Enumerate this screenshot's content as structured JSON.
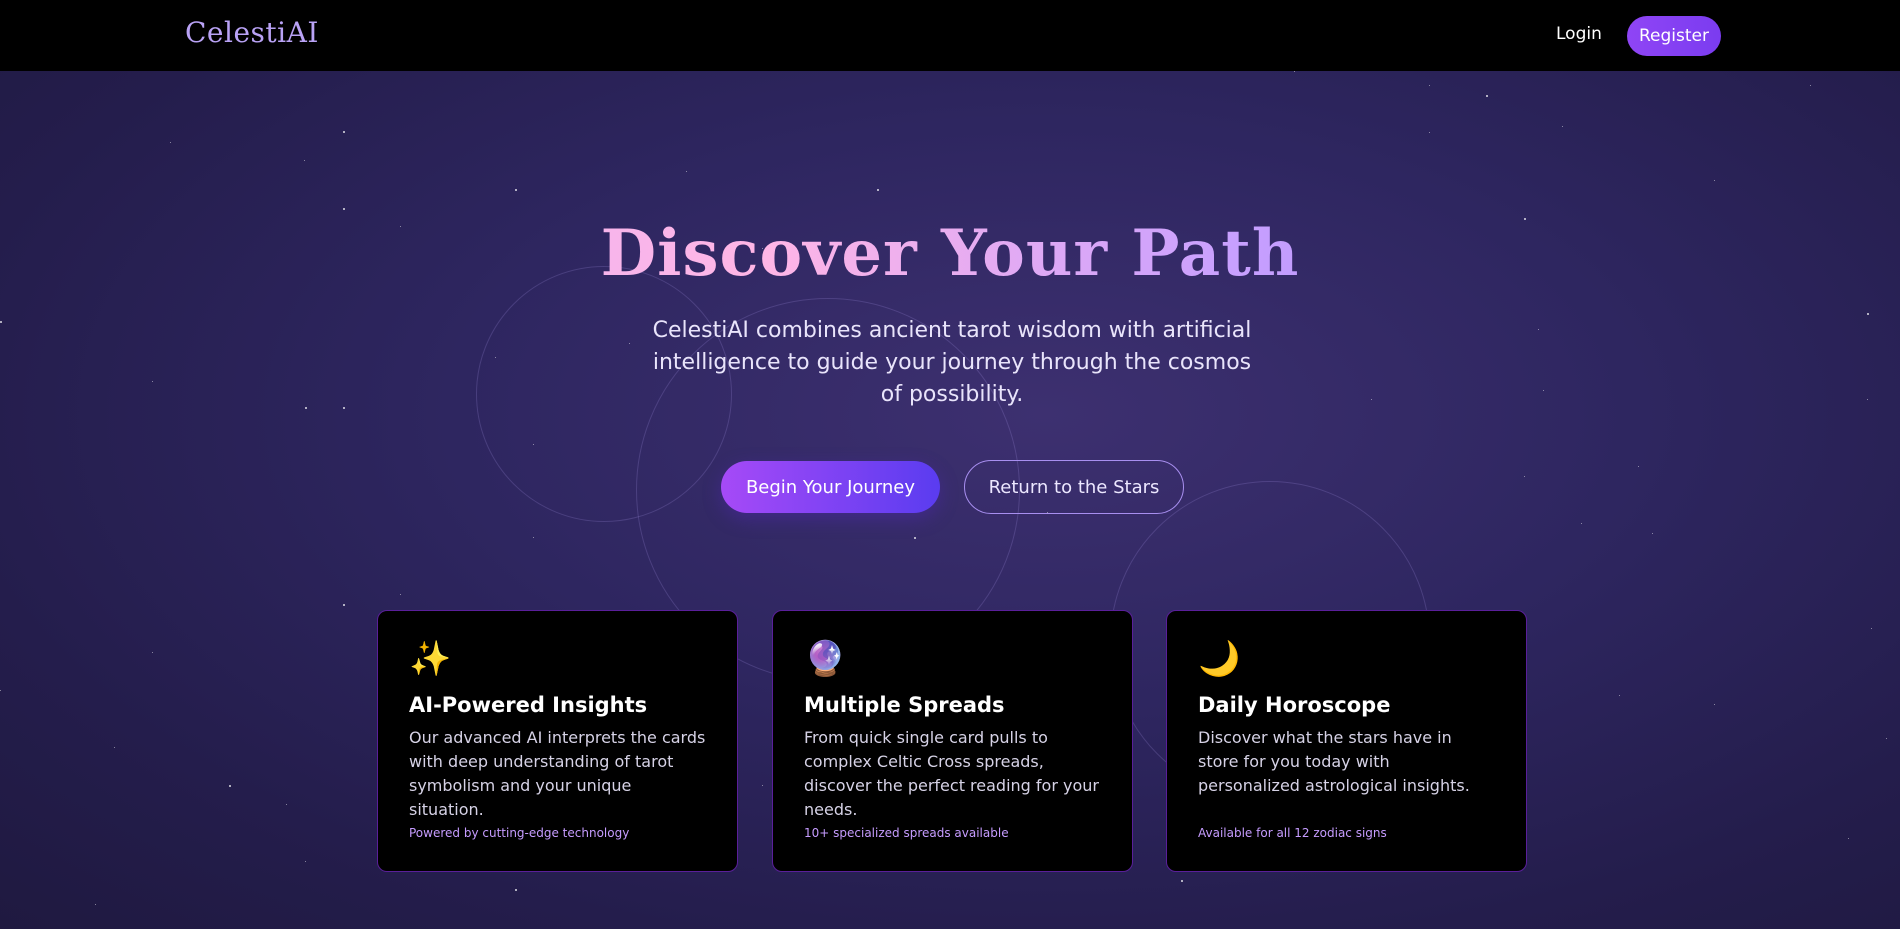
{
  "nav": {
    "brand": "CelestiAI",
    "login": "Login",
    "register": "Register"
  },
  "hero": {
    "title": "Discover Your Path",
    "subtitle": "CelestiAI combines ancient tarot wisdom with artificial intelligence to guide your journey through the cosmos of possibility.",
    "primary_button": "Begin Your Journey",
    "secondary_button": "Return to the Stars"
  },
  "features": [
    {
      "icon": "sparkles-icon",
      "icon_glyph": "✨",
      "title": "AI-Powered Insights",
      "text": "Our advanced AI interprets the cards with deep understanding of tarot symbolism and your unique situation.",
      "note": "Powered by cutting-edge technology"
    },
    {
      "icon": "crystal-ball-icon",
      "icon_glyph": "🔮",
      "title": "Multiple Spreads",
      "text": "From quick single card pulls to complex Celtic Cross spreads, discover the perfect reading for your needs.",
      "note": "10+ specialized spreads available"
    },
    {
      "icon": "crescent-moon-icon",
      "icon_glyph": "🌙",
      "title": "Daily Horoscope",
      "text": "Discover what the stars have in store for you today with personalized astrological insights.",
      "note": "Available for all 12 zodiac signs"
    }
  ],
  "colors": {
    "accent": "#8f45f5",
    "card_border": "#5a1f9a",
    "note_text": "#c69cff"
  }
}
